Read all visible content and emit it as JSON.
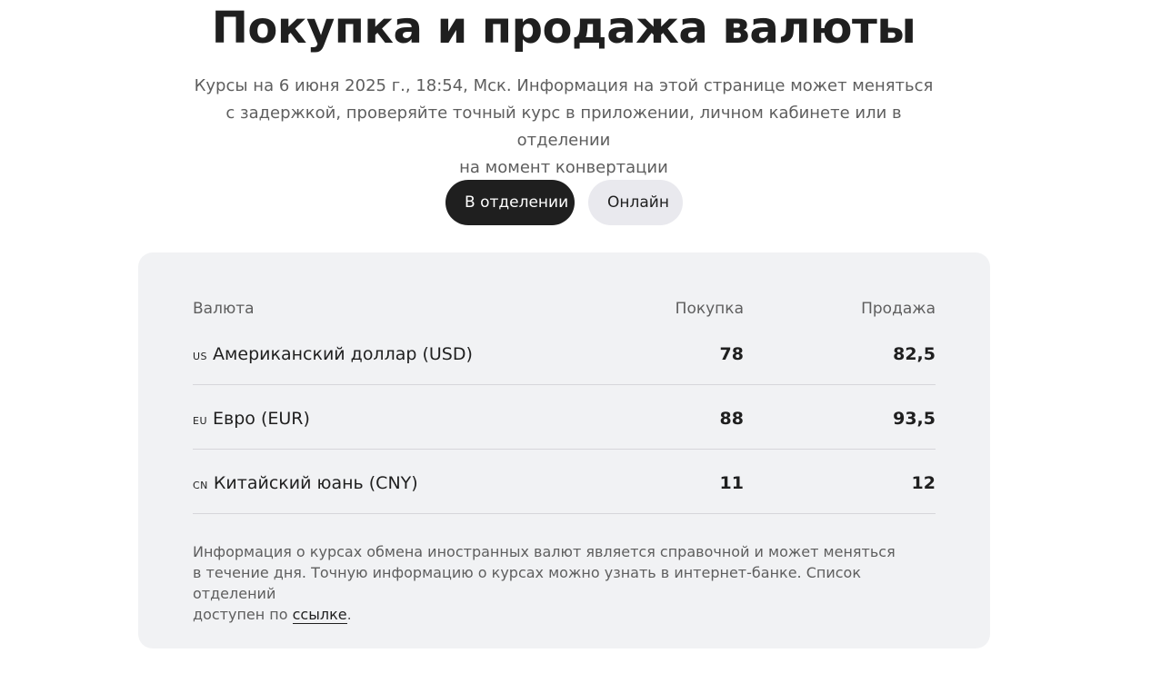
{
  "title": "Покупка и продажа валюты",
  "subtitle": {
    "line1": "Курсы на 6 июня 2025 г., 18:54, Мск. Информация на этой странице может меняться",
    "line2": "с задержкой, проверяйте точный курс в приложении, личном кабинете или в отделении",
    "line3": "на момент конвертации"
  },
  "tabs": [
    {
      "label": "В отделении",
      "active": true
    },
    {
      "label": "Онлайн",
      "active": false
    }
  ],
  "table": {
    "headers": {
      "currency": "Валюта",
      "buy": "Покупка",
      "sell": "Продажа"
    },
    "rows": [
      {
        "code": "us",
        "name": "Американский доллар (USD)",
        "buy": "78",
        "sell": "82,5"
      },
      {
        "code": "eu",
        "name": "Евро (EUR)",
        "buy": "88",
        "sell": "93,5"
      },
      {
        "code": "cn",
        "name": "Китайский юань (CNY)",
        "buy": "11",
        "sell": "12"
      }
    ]
  },
  "note": {
    "line1": "Информация о курсах обмена иностранных валют является справочной и может меняться",
    "line2": "в течение дня. Точную информацию о курсах можно узнать в интернет-банке. Список отделений",
    "line3_prefix": "доступен по ",
    "link_text": "ссылке",
    "line3_suffix": "."
  },
  "colors": {
    "active_tab": "#1f1f1f",
    "inactive_tab": "#e9e9ee",
    "card_background": "#f1f2f4"
  }
}
